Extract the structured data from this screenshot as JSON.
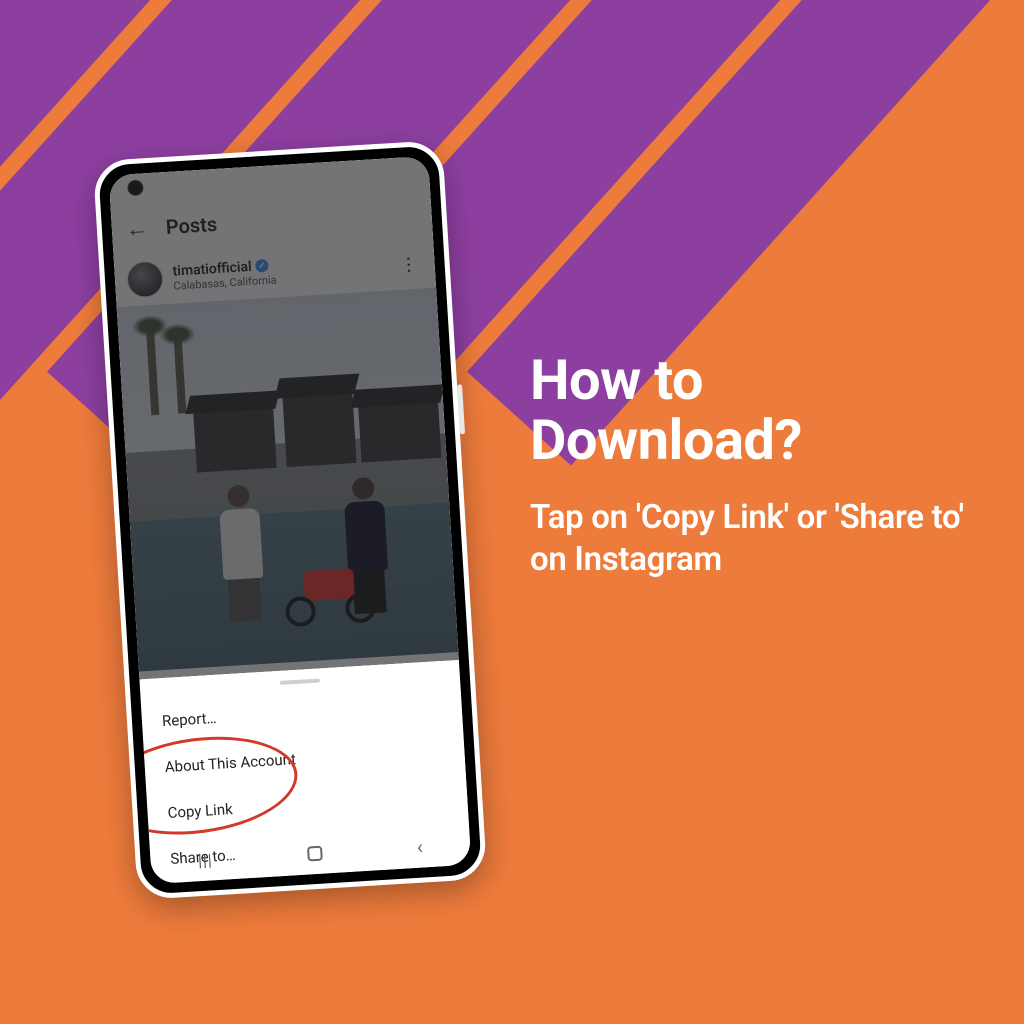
{
  "hero": {
    "title": "How to Download?",
    "subtitle": "Tap on 'Copy Link' or 'Share to' on Instagram"
  },
  "screen": {
    "header_title": "Posts",
    "username": "timatiofficial",
    "location": "Calabasas, California"
  },
  "sheet": {
    "items": [
      "Report…",
      "About This Account",
      "Copy Link",
      "Share to…"
    ]
  },
  "colors": {
    "bg": "#ed7b3c",
    "stripe": "#8d3fa0",
    "highlight": "#d13a2a"
  }
}
